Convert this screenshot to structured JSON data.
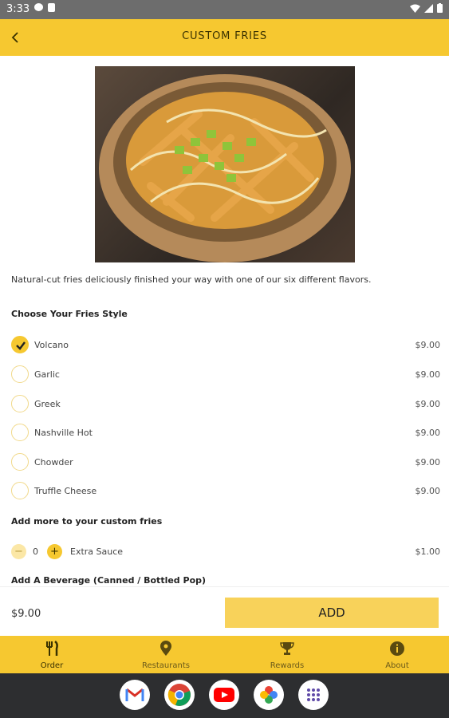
{
  "status_bar": {
    "time": "3:33"
  },
  "header": {
    "title": "CUSTOM FRIES"
  },
  "product": {
    "description": "Natural-cut fries deliciously finished your way with one of our six different flavors."
  },
  "fries_style": {
    "title": "Choose Your Fries Style",
    "options": [
      {
        "label": "Volcano",
        "price": "$9.00",
        "selected": true
      },
      {
        "label": "Garlic",
        "price": "$9.00",
        "selected": false
      },
      {
        "label": "Greek",
        "price": "$9.00",
        "selected": false
      },
      {
        "label": "Nashville Hot",
        "price": "$9.00",
        "selected": false
      },
      {
        "label": "Chowder",
        "price": "$9.00",
        "selected": false
      },
      {
        "label": "Truffle Cheese",
        "price": "$9.00",
        "selected": false
      }
    ]
  },
  "addons": {
    "title": "Add more to your custom fries",
    "items": [
      {
        "label": "Extra Sauce",
        "quantity": "0",
        "price": "$1.00",
        "minus": "−",
        "plus": "+"
      }
    ]
  },
  "beverage": {
    "title": "Add A Beverage (Canned / Bottled Pop)"
  },
  "cart": {
    "total": "$9.00",
    "add_label": "ADD"
  },
  "bottom_nav": [
    {
      "label": "Order",
      "icon": "fork-knife-icon",
      "active": true
    },
    {
      "label": "Restaurants",
      "icon": "location-pin-icon",
      "active": false
    },
    {
      "label": "Rewards",
      "icon": "trophy-icon",
      "active": false
    },
    {
      "label": "About",
      "icon": "info-icon",
      "active": false
    }
  ],
  "dock": [
    "gmail-icon",
    "chrome-icon",
    "youtube-icon",
    "photos-icon",
    "app-drawer-icon"
  ],
  "colors": {
    "brand_yellow": "#f6c830",
    "add_button": "#f8d25a",
    "system_nav": "#2d2e30"
  }
}
